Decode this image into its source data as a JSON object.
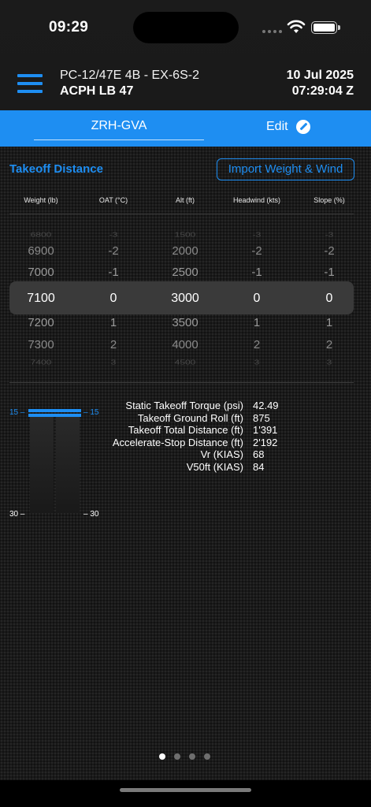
{
  "status": {
    "time": "09:29"
  },
  "header": {
    "aircraft_model": "PC-12/47E 4B - EX-6S-2",
    "aircraft_reg": "ACPH LB 47",
    "date": "10 Jul 2025",
    "time": "07:29:04 Z"
  },
  "tabs": {
    "route": "ZRH-GVA",
    "edit": "Edit"
  },
  "section": {
    "title": "Takeoff Distance",
    "import_button": "Import Weight & Wind"
  },
  "columns": [
    "Weight (lb)",
    "OAT (°C)",
    "Alt (ft)",
    "Headwind (kts)",
    "Slope (%)"
  ],
  "picker_rows": [
    [
      "6800",
      "-3",
      "1500",
      "-3",
      "-3"
    ],
    [
      "6900",
      "-2",
      "2000",
      "-2",
      "-2"
    ],
    [
      "7000",
      "-1",
      "2500",
      "-1",
      "-1"
    ],
    [
      "7100",
      "0",
      "3000",
      "0",
      "0"
    ],
    [
      "7200",
      "1",
      "3500",
      "1",
      "1"
    ],
    [
      "7300",
      "2",
      "4000",
      "2",
      "2"
    ],
    [
      "7400",
      "3",
      "4500",
      "3",
      "3"
    ]
  ],
  "gauge": {
    "top_left": "15 –",
    "top_right": "– 15",
    "bottom_left": "30 –",
    "bottom_right": "– 30"
  },
  "results": [
    {
      "label": "Static Takeoff Torque (psi)",
      "value": "42.49"
    },
    {
      "label": "Takeoff Ground Roll (ft)",
      "value": "875"
    },
    {
      "label": "Takeoff Total Distance (ft)",
      "value": "1'391"
    },
    {
      "label": "Accelerate-Stop Distance (ft)",
      "value": "2'192"
    },
    {
      "label": "Vr (KIAS)",
      "value": "68"
    },
    {
      "label": "V50ft (KIAS)",
      "value": "84"
    }
  ],
  "pager": {
    "count": 4,
    "active": 0
  },
  "colors": {
    "accent": "#1e8ef2",
    "selection": "#3a3a3a"
  }
}
